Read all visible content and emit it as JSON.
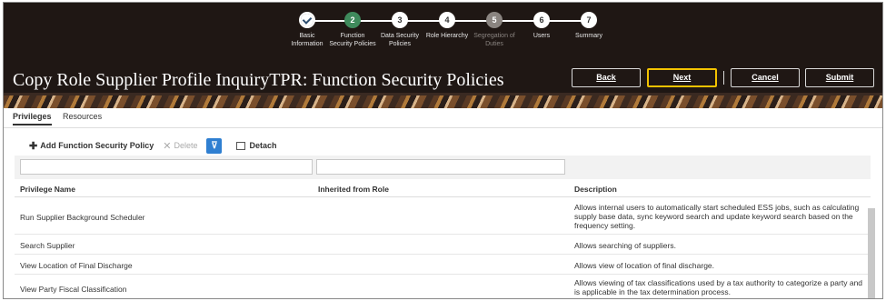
{
  "train": {
    "steps": [
      {
        "number": "",
        "label": "Basic\nInformation",
        "state": "done"
      },
      {
        "number": "2",
        "label": "Function\nSecurity Policies",
        "state": "active"
      },
      {
        "number": "3",
        "label": "Data Security\nPolicies",
        "state": "normal"
      },
      {
        "number": "4",
        "label": "Role Hierarchy",
        "state": "normal"
      },
      {
        "number": "5",
        "label": "Segregation of\nDuties",
        "state": "disabled"
      },
      {
        "number": "6",
        "label": "Users",
        "state": "normal"
      },
      {
        "number": "7",
        "label": "Summary",
        "state": "normal"
      }
    ]
  },
  "header": {
    "title": "Copy Role Supplier Profile InquiryTPR: Function Security Policies",
    "buttons": {
      "back": "Back",
      "next": "Next",
      "cancel": "Cancel",
      "submit": "Submit"
    }
  },
  "tabs": {
    "privileges": "Privileges",
    "resources": "Resources"
  },
  "toolbar": {
    "add": "Add Function Security Policy",
    "delete": "Delete",
    "detach": "Detach"
  },
  "table": {
    "columns": [
      "Privilege Name",
      "Inherited from Role",
      "Description"
    ],
    "rows": [
      {
        "name": "Run Supplier Background Scheduler",
        "inherited": "",
        "description": "Allows internal users to automatically start scheduled ESS jobs, such as calculating supply base data, sync keyword search and update keyword search based on the frequency setting."
      },
      {
        "name": "Search Supplier",
        "inherited": "",
        "description": "Allows searching of suppliers."
      },
      {
        "name": "View Location of Final Discharge",
        "inherited": "",
        "description": "Allows view of location of final discharge."
      },
      {
        "name": "View Party Fiscal Classification",
        "inherited": "",
        "description": "Allows viewing of tax classifications used by a tax authority to categorize a party and is applicable in the tax determination process."
      }
    ]
  },
  "colors": {
    "header_bg": "#1f1714",
    "active_step": "#3f8a5c",
    "next_outline": "#f2c200",
    "toolbar_accent": "#2f7fd1"
  }
}
